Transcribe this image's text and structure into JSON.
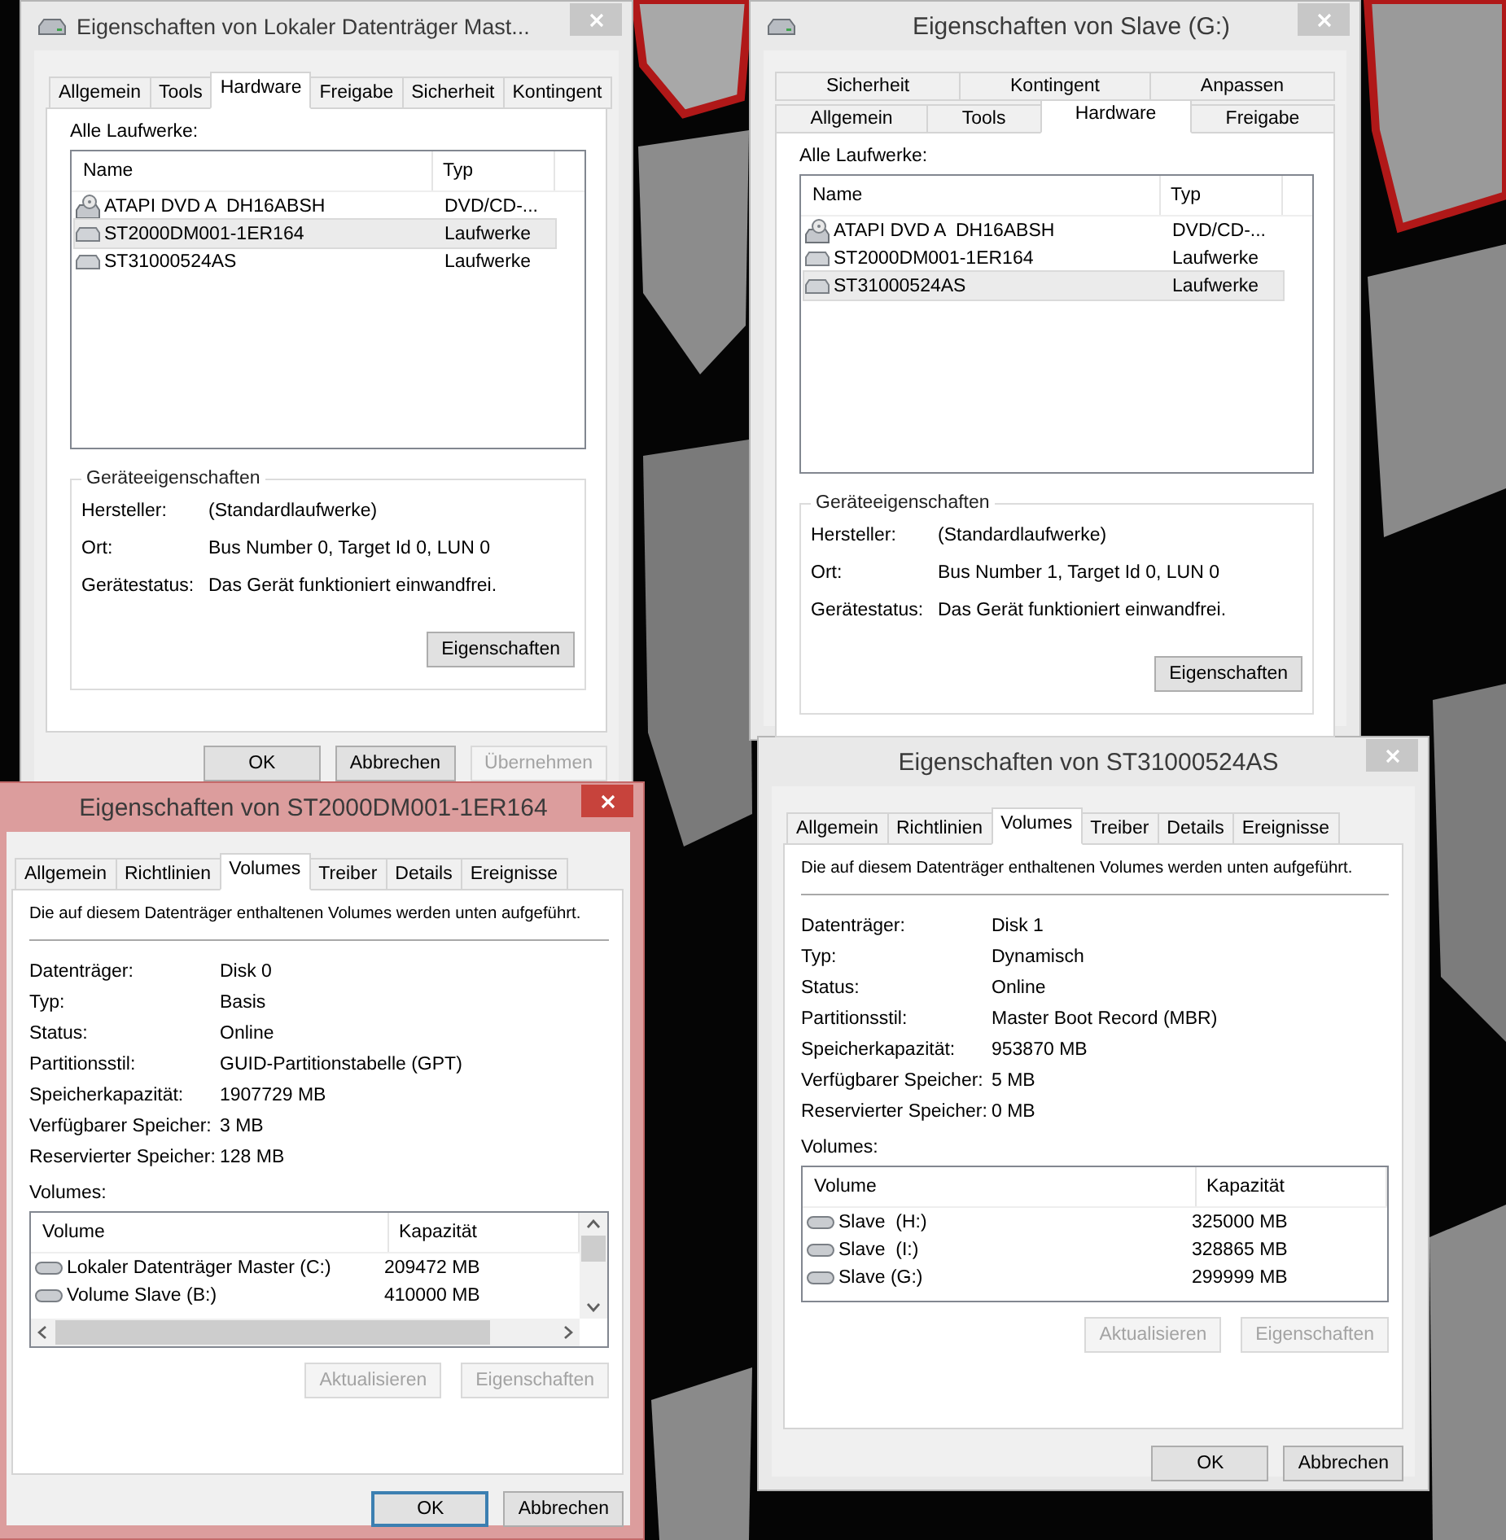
{
  "windows": [
    {
      "kind": "hardware",
      "title": "Eigenschaften von Lokaler Datenträger Mast...",
      "active": false,
      "tab_rows": [
        [
          {
            "label": "Allgemein",
            "selected": false
          },
          {
            "label": "Tools",
            "selected": false
          },
          {
            "label": "Hardware",
            "selected": true
          },
          {
            "label": "Freigabe",
            "selected": false
          },
          {
            "label": "Sicherheit",
            "selected": false
          },
          {
            "label": "Kontingent",
            "selected": false
          }
        ]
      ],
      "hardware": {
        "label": "Alle Laufwerke:",
        "columns": [
          "Name",
          "Typ"
        ],
        "rows": [
          {
            "kind": "dvd",
            "name": "ATAPI DVD A  DH16ABSH",
            "type": "DVD/CD-...",
            "selected": false
          },
          {
            "kind": "disk",
            "name": "ST2000DM001-1ER164",
            "type": "Laufwerke",
            "selected": true
          },
          {
            "kind": "disk",
            "name": "ST31000524AS",
            "type": "Laufwerke",
            "selected": false
          }
        ],
        "group_title": "Geräteeigenschaften",
        "properties": [
          {
            "label": "Hersteller:",
            "value": "(Standardlaufwerke)"
          },
          {
            "label": "Ort:",
            "value": "Bus Number 0, Target Id 0, LUN 0"
          },
          {
            "label": "Gerätestatus:",
            "value": "Das Gerät funktioniert einwandfrei."
          }
        ],
        "button": "Eigenschaften"
      },
      "footer": [
        {
          "label": "OK",
          "disabled": false,
          "default": false
        },
        {
          "label": "Abbrechen",
          "disabled": false,
          "default": false
        },
        {
          "label": "Übernehmen",
          "disabled": true,
          "default": false
        }
      ]
    },
    {
      "kind": "hardware",
      "title": "Eigenschaften von Slave (G:)",
      "active": false,
      "tab_rows": [
        [
          {
            "label": "Sicherheit",
            "selected": false
          },
          {
            "label": "Kontingent",
            "selected": false
          },
          {
            "label": "Anpassen",
            "selected": false
          }
        ],
        [
          {
            "label": "Allgemein",
            "selected": false
          },
          {
            "label": "Tools",
            "selected": false
          },
          {
            "label": "Hardware",
            "selected": true
          },
          {
            "label": "Freigabe",
            "selected": false
          }
        ]
      ],
      "hardware": {
        "label": "Alle Laufwerke:",
        "columns": [
          "Name",
          "Typ"
        ],
        "rows": [
          {
            "kind": "dvd",
            "name": "ATAPI DVD A  DH16ABSH",
            "type": "DVD/CD-...",
            "selected": false
          },
          {
            "kind": "disk",
            "name": "ST2000DM001-1ER164",
            "type": "Laufwerke",
            "selected": false
          },
          {
            "kind": "disk",
            "name": "ST31000524AS",
            "type": "Laufwerke",
            "selected": true
          }
        ],
        "group_title": "Geräteeigenschaften",
        "properties": [
          {
            "label": "Hersteller:",
            "value": "(Standardlaufwerke)"
          },
          {
            "label": "Ort:",
            "value": "Bus Number 1, Target Id 0, LUN 0"
          },
          {
            "label": "Gerätestatus:",
            "value": "Das Gerät funktioniert einwandfrei."
          }
        ],
        "button": "Eigenschaften"
      }
    },
    {
      "kind": "volumes",
      "title": "Eigenschaften von ST2000DM001-1ER164",
      "active": true,
      "tab_rows": [
        [
          {
            "label": "Allgemein",
            "selected": false
          },
          {
            "label": "Richtlinien",
            "selected": false
          },
          {
            "label": "Volumes",
            "selected": true
          },
          {
            "label": "Treiber",
            "selected": false
          },
          {
            "label": "Details",
            "selected": false
          },
          {
            "label": "Ereignisse",
            "selected": false
          }
        ]
      ],
      "volumes": {
        "description": "Die auf diesem Datenträger enthaltenen Volumes werden unten aufgeführt.",
        "properties": [
          {
            "label": "Datenträger:",
            "value": "Disk 0"
          },
          {
            "label": "Typ:",
            "value": "Basis"
          },
          {
            "label": "Status:",
            "value": "Online"
          },
          {
            "label": "Partitionsstil:",
            "value": "GUID-Partitionstabelle (GPT)"
          },
          {
            "label": "Speicherkapazität:",
            "value": "1907729 MB"
          },
          {
            "label": "Verfügbarer Speicher:",
            "value": "3 MB"
          },
          {
            "label": "Reservierter Speicher:",
            "value": "128 MB"
          }
        ],
        "list_label": "Volumes:",
        "columns": [
          "Volume",
          "Kapazität"
        ],
        "scrollable": true,
        "rows": [
          {
            "name": "Lokaler Datenträger Master (C:)",
            "capacity": "209472 MB"
          },
          {
            "name": "Volume Slave (B:)",
            "capacity": "410000 MB"
          }
        ],
        "buttons": [
          {
            "label": "Aktualisieren",
            "disabled": true
          },
          {
            "label": "Eigenschaften",
            "disabled": true
          }
        ]
      },
      "footer": [
        {
          "label": "OK",
          "disabled": false,
          "default": true
        },
        {
          "label": "Abbrechen",
          "disabled": false,
          "default": false
        }
      ]
    },
    {
      "kind": "volumes",
      "title": "Eigenschaften von ST31000524AS",
      "active": false,
      "tab_rows": [
        [
          {
            "label": "Allgemein",
            "selected": false
          },
          {
            "label": "Richtlinien",
            "selected": false
          },
          {
            "label": "Volumes",
            "selected": true
          },
          {
            "label": "Treiber",
            "selected": false
          },
          {
            "label": "Details",
            "selected": false
          },
          {
            "label": "Ereignisse",
            "selected": false
          }
        ]
      ],
      "volumes": {
        "description": "Die auf diesem Datenträger enthaltenen Volumes werden unten aufgeführt.",
        "properties": [
          {
            "label": "Datenträger:",
            "value": "Disk 1"
          },
          {
            "label": "Typ:",
            "value": "Dynamisch"
          },
          {
            "label": "Status:",
            "value": "Online"
          },
          {
            "label": "Partitionsstil:",
            "value": "Master Boot Record (MBR)"
          },
          {
            "label": "Speicherkapazität:",
            "value": "953870 MB"
          },
          {
            "label": "Verfügbarer Speicher:",
            "value": "5 MB"
          },
          {
            "label": "Reservierter Speicher:",
            "value": "0 MB"
          }
        ],
        "list_label": "Volumes:",
        "columns": [
          "Volume",
          "Kapazität"
        ],
        "scrollable": false,
        "rows": [
          {
            "name": "Slave  (H:)",
            "capacity": "325000 MB"
          },
          {
            "name": "Slave  (I:)",
            "capacity": "328865 MB"
          },
          {
            "name": "Slave (G:)",
            "capacity": "299999 MB"
          }
        ],
        "buttons": [
          {
            "label": "Aktualisieren",
            "disabled": true
          },
          {
            "label": "Eigenschaften",
            "disabled": true
          }
        ]
      },
      "footer": [
        {
          "label": "OK",
          "disabled": false,
          "default": false
        },
        {
          "label": "Abbrechen",
          "disabled": false,
          "default": false
        }
      ]
    }
  ]
}
